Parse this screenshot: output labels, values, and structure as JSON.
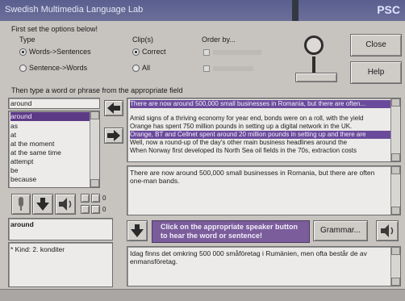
{
  "title": "Swedish Multimedia Language Lab",
  "brand": "PSC",
  "options": {
    "heading": "First set the options below!",
    "type_label": "Type",
    "type_words": "Words->Sentences",
    "type_sentences": "Sentence->Words",
    "clips_label": "Clip(s)",
    "clips_correct": "Correct",
    "clips_all": "All",
    "order_label": "Order by..."
  },
  "buttons": {
    "close": "Close",
    "help": "Help",
    "grammar": "Grammar..."
  },
  "prompt": "Then type a word or phrase from the appropriate field",
  "word_input": "around",
  "word_list": [
    "around",
    "as",
    "at",
    "at the moment",
    "at the same time",
    "attempt",
    "be",
    "because"
  ],
  "counter_a": "0",
  "counter_b": "0",
  "selected_word": "around",
  "grammar_info": "* Kind: 2. konditer",
  "sentences": [
    "There are now around 500,000 small businesses in Romania, but there are often...",
    "Amid signs of a thriving economy for year end, bonds were on a roll, with the yield",
    "Orange has spent 750 million pounds in setting up a digital network in the UK.",
    "Orange, BT and Cellnet spent around 20 million pounds in setting up and there are",
    "Well, now a round-up of the day's other main business headlines around the",
    "When Norway first developed its North Sea oil fields in the 70s, extraction costs"
  ],
  "selected_sentence": "There are now around 500,000 small businesses in Romania, but there are often one-man bands.",
  "speaker_hint": "Click on the appropriate speaker button to hear the word or sentence!",
  "translation": "Idag finns det omkring 500 000 småföretag i Rumänien, men ofta består de av enmansföretag."
}
